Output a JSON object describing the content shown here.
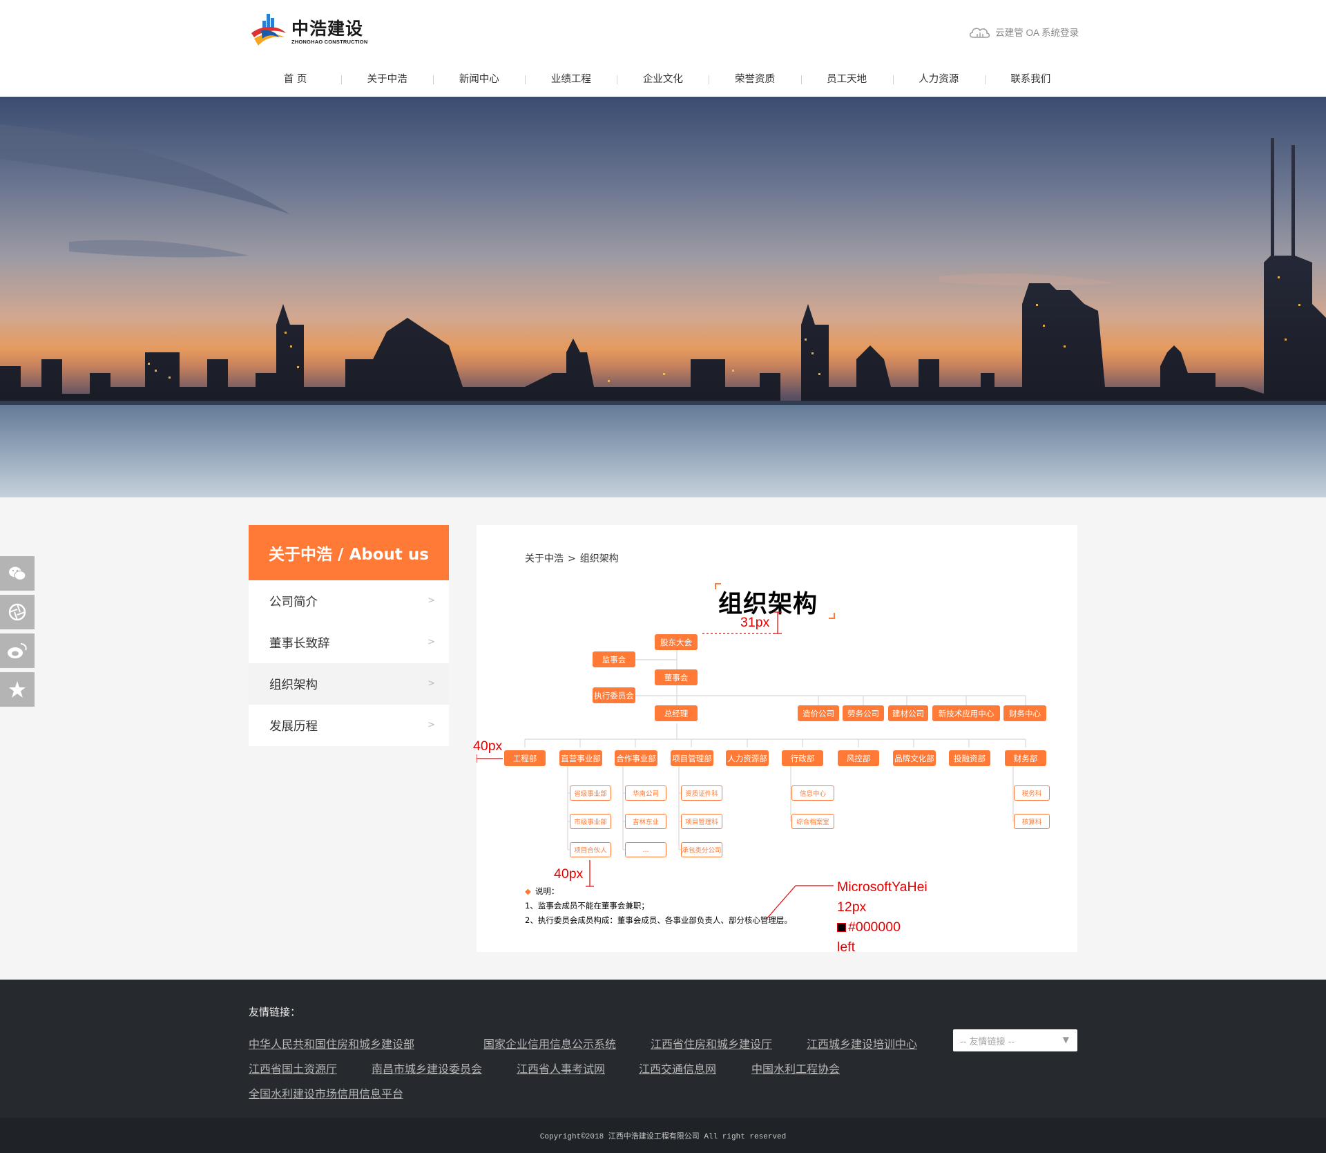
{
  "header": {
    "logo_cn": "中浩建设",
    "logo_en": "ZHONGHAO CONSTRUCTION",
    "oa_login": "云建管 OA 系统登录",
    "nav": [
      "首 页",
      "关于中浩",
      "新闻中心",
      "业绩工程",
      "企业文化",
      "荣誉资质",
      "员工天地",
      "人力资源",
      "联系我们"
    ]
  },
  "colors": {
    "accent": "#ff7a36",
    "footer_bg": "#262a2e",
    "copyright_bg": "#1f2327",
    "annotation": "#e60000"
  },
  "share_icons": [
    "wechat-icon",
    "aperture-icon",
    "weibo-icon",
    "star-icon"
  ],
  "side": {
    "title": "关于中浩 / About us",
    "items": [
      "公司简介",
      "董事长致辞",
      "组织架构",
      "发展历程"
    ],
    "active_index": 2
  },
  "breadcrumb": {
    "parent": "关于中浩",
    "sep": ">",
    "current": "组织架构"
  },
  "org": {
    "title": "组织架构",
    "top": {
      "gudong": "股东大会",
      "jianshi": "监事会",
      "dongshi": "董事会",
      "zhixing": "执行委员会",
      "zongjingli": "总经理"
    },
    "companies": [
      "造价公司",
      "劳务公司",
      "建材公司",
      "新技术应用中心",
      "财务中心"
    ],
    "departments": [
      "工程部",
      "直营事业部",
      "合作事业部",
      "项目管理部",
      "人力资源部",
      "行政部",
      "风控部",
      "品牌文化部",
      "投融资部",
      "财务部"
    ],
    "subs": {
      "zhiying": [
        "省级事业部",
        "市级事业部",
        "项目合伙人"
      ],
      "hezuo": [
        "华南公司",
        "吉林东业",
        "..."
      ],
      "xiangmu": [
        "资质证件科",
        "项目管理科",
        "承包类分公司"
      ],
      "xingzheng": [
        "信息中心",
        "综合档案室"
      ],
      "caiwu": [
        "税务科",
        "核算科"
      ]
    },
    "note_title": "说明：",
    "notes": [
      "1、监事会成员不能在董事会兼职；",
      "2、执行委员会成员构成：董事会成员、各事业部负责人、部分核心管理层。"
    ]
  },
  "annotations": {
    "a31": "31px",
    "a40a": "40px",
    "a40b": "40px",
    "font": "MicrosoftYaHei",
    "size": "12px",
    "color": "#000000",
    "align": "left"
  },
  "footer": {
    "title": "友情链接：",
    "links": [
      "中华人民共和国住房和城乡建设部",
      "国家企业信用信息公示系统",
      "江西省住房和城乡建设厅",
      "江西城乡建设培训中心",
      "江西省国土资源厅",
      "南昌市城乡建设委员会",
      "江西省人事考试网",
      "江西交通信息网",
      "中国水利工程协会",
      "全国水利建设市场信用信息平台"
    ],
    "select_placeholder": "-- 友情链接 --",
    "copyright": "Copyright©2018 江西中浩建设工程有限公司 All right reserved"
  }
}
